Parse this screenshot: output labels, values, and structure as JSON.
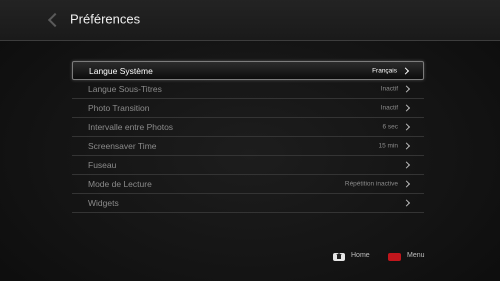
{
  "header": {
    "title": "Préférences",
    "back_icon": "chevron-left-icon"
  },
  "menu": {
    "items": [
      {
        "label": "Langue Système",
        "value": "Français",
        "selected": true
      },
      {
        "label": "Langue Sous-Titres",
        "value": "Inactif",
        "selected": false
      },
      {
        "label": "Photo Transition",
        "value": "Inactif",
        "selected": false
      },
      {
        "label": "Intervalle entre Photos",
        "value": "6 sec",
        "selected": false
      },
      {
        "label": "Screensaver Time",
        "value": "15 min",
        "selected": false
      },
      {
        "label": "Fuseau",
        "value": "",
        "selected": false
      },
      {
        "label": "Mode de Lecture",
        "value": "Répétition inactive",
        "selected": false
      },
      {
        "label": "Widgets",
        "value": "",
        "selected": false
      }
    ]
  },
  "footer": {
    "home_label": "Home",
    "menu_label": "Menu",
    "home_icon": "home-icon",
    "menu_key_color": "#c0161c"
  }
}
